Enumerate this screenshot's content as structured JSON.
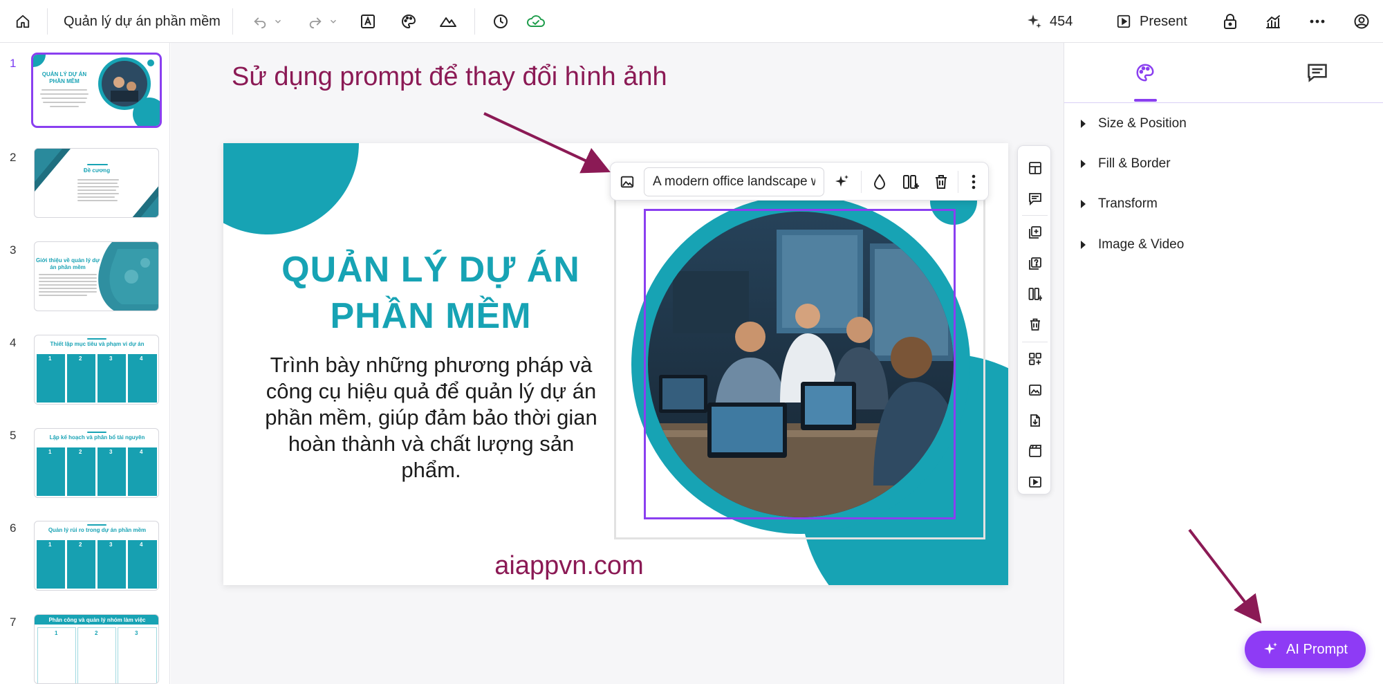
{
  "topbar": {
    "doc_title": "Quản lý dự án phần mềm",
    "credits": "454",
    "present_label": "Present"
  },
  "slides_panel": {
    "items": [
      {
        "number": "1",
        "title": "QUẢN LÝ DỰ ÁN PHẦN MỀM"
      },
      {
        "number": "2",
        "title": "Đề cương"
      },
      {
        "number": "3",
        "title": "Giới thiệu về quản lý dự án phần mềm"
      },
      {
        "number": "4",
        "title": "Thiết lập mục tiêu và phạm vi dự án",
        "cols": [
          "1",
          "2",
          "3",
          "4"
        ]
      },
      {
        "number": "5",
        "title": "Lập kế hoạch và phân bổ tài nguyên",
        "cols": [
          "1",
          "2",
          "3",
          "4"
        ]
      },
      {
        "number": "6",
        "title": "Quản lý rủi ro trong dự án phần mềm",
        "cols": [
          "1",
          "2",
          "3",
          "4"
        ]
      },
      {
        "number": "7",
        "title": "Phân công và quản lý nhóm làm việc",
        "cols": [
          "1",
          "2",
          "3"
        ]
      }
    ]
  },
  "canvas": {
    "annotation": "Sử dụng prompt để thay đổi hình ảnh",
    "slide_title_line1": "QUẢN LÝ DỰ ÁN",
    "slide_title_line2": "PHẦN MỀM",
    "slide_subtitle": "Trình bày những phương pháp và công cụ hiệu quả để quản lý dự án phần mềm, giúp đảm bảo thời gian hoàn thành và chất lượng sản phẩm.",
    "website": "aiappvn.com",
    "image_prompt_value": "A modern office landscape w"
  },
  "properties": {
    "sections": [
      "Size & Position",
      "Fill & Border",
      "Transform",
      "Image & Video"
    ]
  },
  "ai_prompt_label": "AI Prompt",
  "colors": {
    "accent": "#8a3ff0",
    "teal": "#17a3b4",
    "annotation": "#8b1a55"
  }
}
